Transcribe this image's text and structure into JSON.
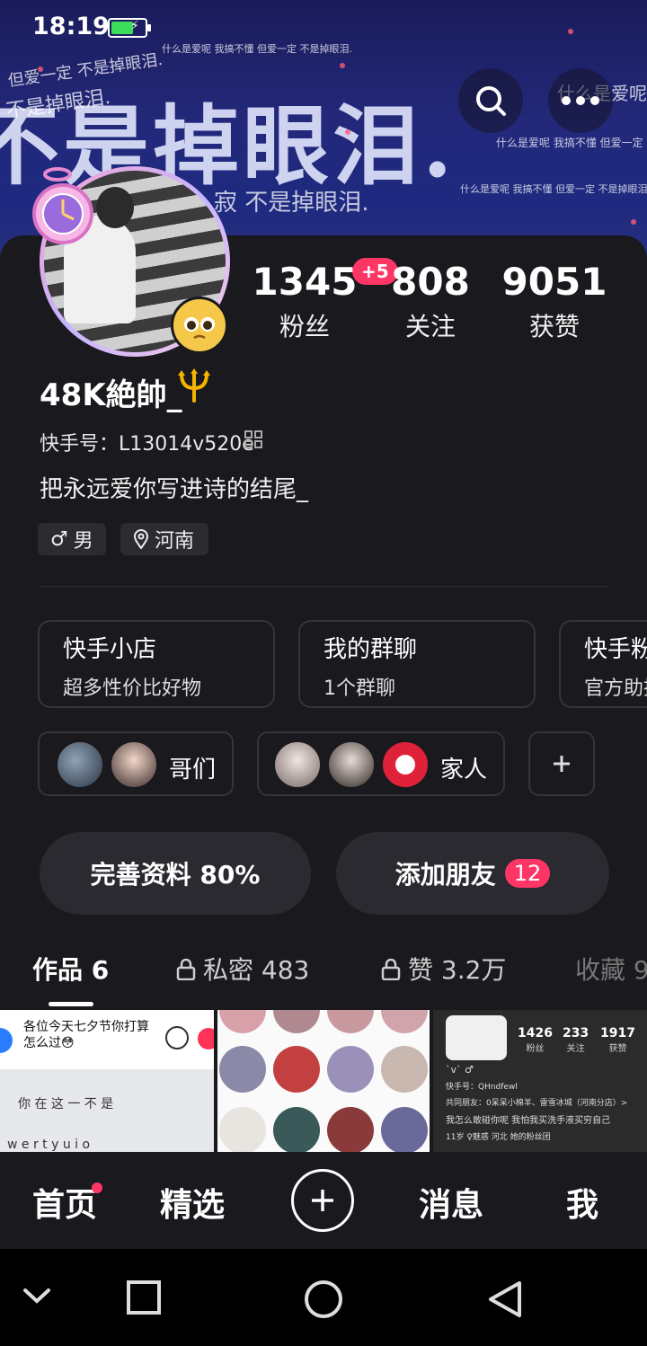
{
  "status_bar": {
    "time": "18:19"
  },
  "banner": {
    "big_text": "不是掉眼泪.",
    "lines": [
      "什么是爱呢 我搞不懂 但爱一定 不是掉眼泪.",
      "但爱一定 不是掉眼泪.",
      "不是掉眼泪.",
      "什么是爱呢",
      "什么是爱呢 我搞不懂 但爱一定",
      "什么是爱呢 我搞不懂 但爱一定 不是掉眼泪",
      "寂 不是掉眼泪."
    ]
  },
  "profile": {
    "stats": [
      {
        "value": "1345",
        "label": "粉丝"
      },
      {
        "value": "808",
        "label": "关注"
      },
      {
        "value": "9051",
        "label": "获赞"
      }
    ],
    "fans_increase": "+5",
    "username": "48K絶帥_",
    "kuaishou_id": "快手号：L13014v520e",
    "bio": "把永远爱你写进诗的结尾_",
    "tags": {
      "gender": "男",
      "region": "河南"
    }
  },
  "features": [
    {
      "title": "快手小店",
      "subtitle": "超多性价比好物"
    },
    {
      "title": "我的群聊",
      "subtitle": "1个群聊"
    },
    {
      "title": "快手粉",
      "subtitle": "官方助推"
    }
  ],
  "circles": {
    "bros": "哥们",
    "family": "家人"
  },
  "actions": {
    "complete_profile": "完善资料 80%",
    "add_friends": "添加朋友",
    "add_friends_count": "12"
  },
  "tabs": {
    "works": "作品 6",
    "private": "私密 483",
    "likes": "赞 3.2万",
    "favorites": "收藏 9"
  },
  "thumbnails": {
    "t1_text": "各位今天七夕节你打算怎么过😳",
    "t1_row1": "你  在  这  一  不  是",
    "t1_row2": "w  e  r  t  y  u  i  o",
    "t3": {
      "stats": [
        {
          "value": "1426",
          "label": "粉丝"
        },
        {
          "value": "233",
          "label": "关注"
        },
        {
          "value": "1917",
          "label": "获赞"
        }
      ],
      "name": "`v` ♂",
      "id": "快手号：QHndfewl",
      "mutual": "共同朋友：0呆呆小棉羊、雷雪冰城（河南分店）>",
      "bio": "我怎么敢碰你呢 我怕我买洗手液买穷自己",
      "tags": "11岁 ♀魅惑  河北  她的粉丝团"
    }
  },
  "bottom_nav": {
    "home": "首页",
    "featured": "精选",
    "messages": "消息",
    "me": "我"
  }
}
